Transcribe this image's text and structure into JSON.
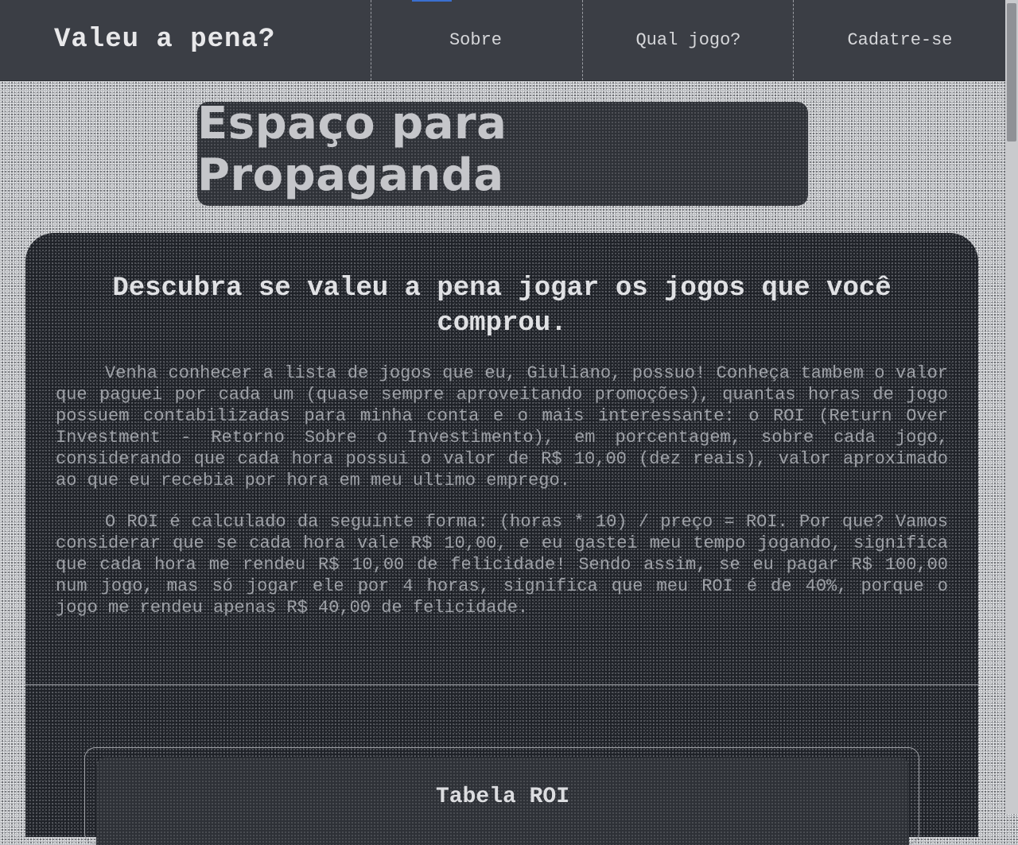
{
  "header": {
    "site_title": "Valeu a pena?",
    "nav": [
      {
        "label": "Sobre"
      },
      {
        "label": "Qual jogo?"
      },
      {
        "label": "Cadatre-se"
      }
    ]
  },
  "ad": {
    "text": "Espaço para Propaganda"
  },
  "main": {
    "headline": "Descubra se valeu a pena jogar os jogos que você comprou.",
    "paragraphs": [
      "Venha conhecer a lista de jogos que eu, Giuliano, possuo! Conheça tambem o valor que paguei por cada um (quase sempre aproveitando promoções), quantas horas de jogo possuem contabilizadas para minha conta e o mais interessante: o ROI (Return Over Investment - Retorno Sobre o Investimento), em porcentagem, sobre cada jogo, considerando que cada hora possui o valor de R$ 10,00 (dez reais), valor aproximado ao que eu recebia por hora em meu ultimo emprego.",
      "O ROI é calculado da seguinte forma: (horas * 10) / preço = ROI. Por que? Vamos considerar que se cada hora vale R$ 10,00, e eu gastei meu tempo jogando, significa que cada hora me rendeu R$ 10,00 de felicidade! Sendo assim, se eu pagar R$ 100,00 num jogo, mas só jogar ele por 4 horas, significa que meu ROI é de 40%, porque o jogo me rendeu apenas R$ 40,00 de felicidade."
    ]
  },
  "roi_section": {
    "title": "Tabela ROI"
  },
  "colors": {
    "header_bg": "#3b3e45",
    "panel_bg": "#1f2228",
    "accent": "#3a6fd0"
  }
}
